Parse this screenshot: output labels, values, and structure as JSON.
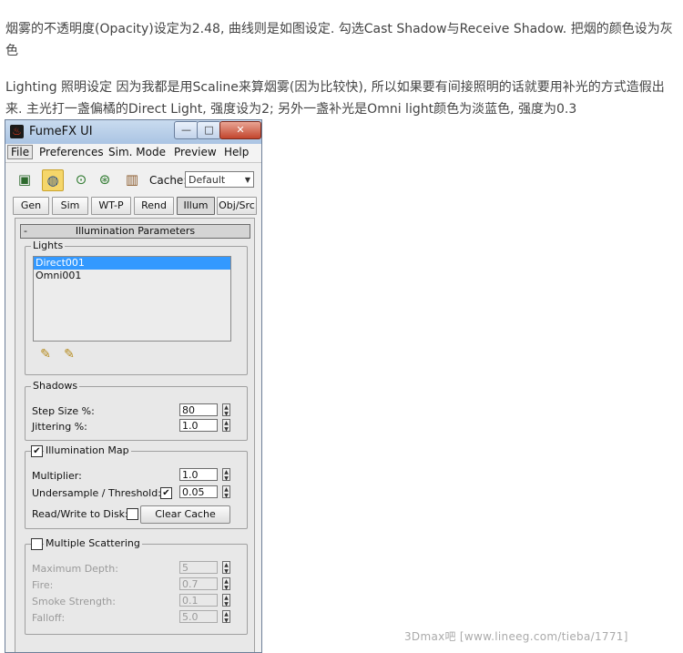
{
  "article": {
    "p1": "烟雾的不透明度(Opacity)设定为2.48, 曲线则是如图设定. 勾选Cast Shadow与Receive Shadow. 把烟的颜色设为灰色",
    "p2": "Lighting 照明设定 因为我都是用Scaline来算烟雾(因为比较快), 所以如果要有间接照明的话就要用补光的方式造假出来. 主光打一盏偏橘的Direct Light, 强度设为2; 另外一盏补光是Omni light颜色为淡蓝色, 强度为0.3"
  },
  "window": {
    "title": "FumeFX UI",
    "icon": "fire-icon"
  },
  "menu": [
    "File",
    "Preferences",
    "Sim. Mode",
    "Preview",
    "Help"
  ],
  "toolbar": {
    "cache_label": "Cache:",
    "cache_value": "Default"
  },
  "tabs": [
    "Gen",
    "Sim",
    "WT-P",
    "Rend",
    "Illum",
    "Obj/Src"
  ],
  "rollout": {
    "title": "Illumination Parameters",
    "toggle": "-"
  },
  "lights": {
    "label": "Lights",
    "items": [
      "Direct001",
      "Omni001"
    ],
    "selected": 0
  },
  "shadows": {
    "label": "Shadows",
    "step_size_label": "Step Size %:",
    "step_size": "80",
    "jittering_label": "Jittering %:",
    "jittering": "1.0"
  },
  "illum_map": {
    "label": "Illumination Map",
    "checked": true,
    "multiplier_label": "Multiplier:",
    "multiplier": "1.0",
    "undersample_label": "Undersample / Threshold:",
    "undersample_checked": true,
    "threshold": "0.05",
    "rw_label": "Read/Write to Disk:",
    "rw_checked": false,
    "clear_cache": "Clear Cache"
  },
  "scattering": {
    "label": "Multiple Scattering",
    "checked": false,
    "max_depth_label": "Maximum Depth:",
    "max_depth": "5",
    "fire_label": "Fire:",
    "fire": "0.7",
    "smoke_strength_label": "Smoke Strength:",
    "smoke_strength": "0.1",
    "falloff_label": "Falloff:",
    "falloff": "5.0"
  },
  "watermark": "3Dmax吧  [www.lineeg.com/tieba/1771]"
}
